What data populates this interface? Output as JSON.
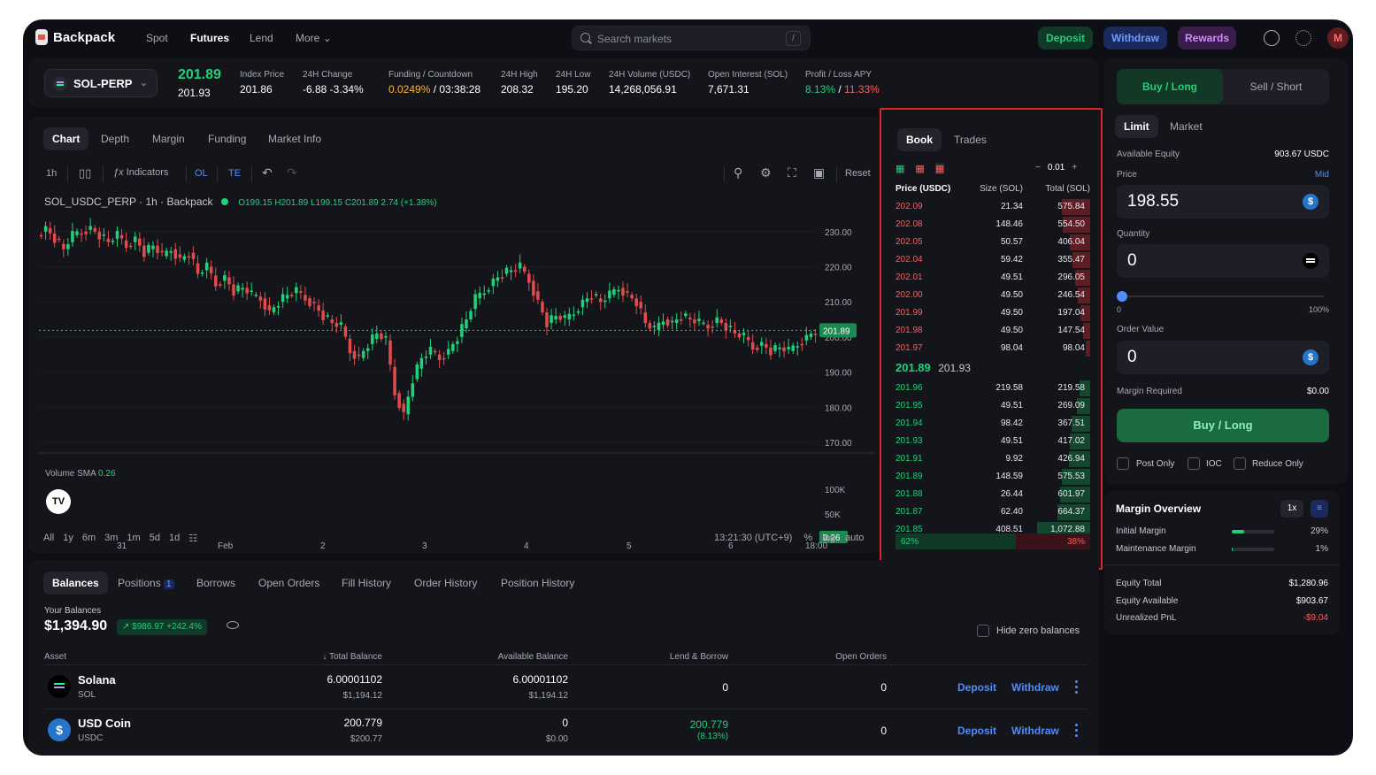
{
  "app": {
    "name": "Backpack"
  },
  "nav": {
    "items": [
      "Spot",
      "Futures",
      "Lend",
      "More"
    ],
    "active": "Futures"
  },
  "search": {
    "placeholder": "Search markets",
    "shortcut": "/"
  },
  "header_actions": {
    "deposit": "Deposit",
    "withdraw": "Withdraw",
    "rewards": "Rewards",
    "avatar": "M"
  },
  "colors": {
    "green": "#20d07a",
    "red": "#ff5b5b",
    "blue": "#4e8cff",
    "bg": "#0e0f14",
    "panel": "#14151b"
  },
  "market": {
    "symbol": "SOL-PERP",
    "last_price": "201.89",
    "mark_price": "201.93",
    "stats": [
      {
        "label": "Index Price",
        "value": "201.86"
      },
      {
        "label": "24H Change",
        "value": "-6.88 -3.34%"
      },
      {
        "label": "Funding / Countdown",
        "value": "0.0249%",
        "value2": " / 03:38:28"
      },
      {
        "label": "24H High",
        "value": "208.32"
      },
      {
        "label": "24H Low",
        "value": "195.20"
      },
      {
        "label": "24H Volume (USDC)",
        "value": "14,268,056.91"
      },
      {
        "label": "Open Interest (SOL)",
        "value": "7,671.31"
      },
      {
        "label": "Profit / Loss APY",
        "value": "8.13%",
        "value2": " / ",
        "value3": "11.33%"
      }
    ]
  },
  "chart_tabs": [
    "Chart",
    "Depth",
    "Margin",
    "Funding",
    "Market Info"
  ],
  "chart_toolbar": {
    "interval": "1h",
    "indicators": "Indicators",
    "ol": "OL",
    "te": "TE",
    "reset": "Reset"
  },
  "chart_legend": {
    "title": "SOL_USDC_PERP · 1h · Backpack",
    "o": "O199.15",
    "h": "H201.89",
    "l": "L199.15",
    "c": "C201.89",
    "chg": "2.74 (+1.38%)",
    "volume_label": "Volume SMA",
    "volume_value": "0.26"
  },
  "chart_data": {
    "type": "candlestick",
    "series_name": "SOL_USDC_PERP",
    "ylim": [
      170,
      235
    ],
    "y_ticks": [
      "230.00",
      "220.00",
      "210.00",
      "200.00",
      "190.00",
      "180.00",
      "170.00"
    ],
    "x_ticks": [
      "31",
      "Feb",
      "2",
      "3",
      "4",
      "5",
      "6",
      "18:00"
    ],
    "last_price_tag": "201.89",
    "volume_ticks": [
      "100K",
      "50K"
    ],
    "volume_tag": "0.26",
    "path": [
      229,
      231,
      228,
      225,
      229,
      230,
      231,
      229,
      227,
      229,
      226,
      228,
      224,
      226,
      223,
      225,
      222,
      224,
      218,
      220,
      215,
      217,
      213,
      214,
      212,
      211,
      207,
      210,
      212,
      213,
      211,
      209,
      206,
      204,
      203,
      196,
      194,
      198,
      201,
      199,
      184,
      178,
      188,
      194,
      196,
      194,
      196,
      200,
      205,
      211,
      213,
      216,
      218,
      219,
      220,
      216,
      210,
      204,
      206,
      205,
      207,
      210,
      212,
      210,
      212,
      214,
      212,
      210,
      204,
      202,
      205,
      204,
      206,
      205,
      204,
      203,
      205,
      203,
      201,
      200,
      197,
      198,
      196,
      197,
      196,
      198,
      200,
      201.89
    ]
  },
  "range_bar": {
    "ranges": [
      "All",
      "1y",
      "6m",
      "3m",
      "1m",
      "5d",
      "1d"
    ],
    "time": "13:21:30 (UTC+9)",
    "pct": "%",
    "log": "log",
    "auto": "auto"
  },
  "book": {
    "tabs": [
      "Book",
      "Trades"
    ],
    "tick": "0.01",
    "headers": [
      "Price (USDC)",
      "Size (SOL)",
      "Total (SOL)"
    ],
    "asks": [
      [
        "202.09",
        "21.34",
        "575.84"
      ],
      [
        "202.08",
        "148.46",
        "554.50"
      ],
      [
        "202.05",
        "50.57",
        "406.04"
      ],
      [
        "202.04",
        "59.42",
        "355.47"
      ],
      [
        "202.01",
        "49.51",
        "296.05"
      ],
      [
        "202.00",
        "49.50",
        "246.54"
      ],
      [
        "201.99",
        "49.50",
        "197.04"
      ],
      [
        "201.98",
        "49.50",
        "147.54"
      ],
      [
        "201.97",
        "98.04",
        "98.04"
      ]
    ],
    "mid": "201.89",
    "mark": "201.93",
    "bids": [
      [
        "201.96",
        "219.58",
        "219.58"
      ],
      [
        "201.95",
        "49.51",
        "269.09"
      ],
      [
        "201.94",
        "98.42",
        "367.51"
      ],
      [
        "201.93",
        "49.51",
        "417.02"
      ],
      [
        "201.91",
        "9.92",
        "426.94"
      ],
      [
        "201.89",
        "148.59",
        "575.53"
      ],
      [
        "201.88",
        "26.44",
        "601.97"
      ],
      [
        "201.87",
        "62.40",
        "664.37"
      ],
      [
        "201.85",
        "408.51",
        "1,072.88"
      ]
    ],
    "bid_pct": "62%",
    "ask_pct": "38%",
    "bid_ratio": 0.62
  },
  "order": {
    "side_buy": "Buy / Long",
    "side_sell": "Sell / Short",
    "types": [
      "Limit",
      "Market"
    ],
    "available_label": "Available Equity",
    "available_value": "903.67 USDC",
    "price_label": "Price",
    "mid_label": "Mid",
    "price_value": "198.55",
    "qty_label": "Quantity",
    "qty_value": "0",
    "slider_min": "0",
    "slider_max": "100%",
    "slider_level": 0,
    "value_label": "Order Value",
    "value_value": "0",
    "margin_label": "Margin Required",
    "margin_value": "$0.00",
    "submit": "Buy / Long",
    "options": [
      "Post Only",
      "IOC",
      "Reduce Only"
    ]
  },
  "margin_overview": {
    "title": "Margin Overview",
    "leverage": "1x",
    "rows": [
      {
        "label": "Initial Margin",
        "value": "29%",
        "level": 0.29
      },
      {
        "label": "Maintenance Margin",
        "value": "1%",
        "level": 0.01
      }
    ],
    "equity": [
      {
        "label": "Equity Total",
        "value": "$1,280.96"
      },
      {
        "label": "Equity Available",
        "value": "$903.67"
      },
      {
        "label": "Unrealized PnL",
        "value": "-$9.04"
      }
    ]
  },
  "balances": {
    "tabs": [
      "Balances",
      "Positions",
      "Borrows",
      "Open Orders",
      "Fill History",
      "Order History",
      "Position History"
    ],
    "positions_count": "1",
    "your_label": "Your Balances",
    "total": "$1,394.90",
    "change": "$986.97 +242.4%",
    "hide_zero": "Hide zero balances",
    "columns": [
      "Asset",
      "Total Balance",
      "Available Balance",
      "Lend & Borrow",
      "Open Orders"
    ],
    "rows": [
      {
        "name": "Solana",
        "ticker": "SOL",
        "total": "6.00001102",
        "total_usd": "$1,194.12",
        "avail": "6.00001102",
        "avail_usd": "$1,194.12",
        "lend": "0",
        "lend_sub": "",
        "open": "0",
        "deposit": "Deposit",
        "withdraw": "Withdraw"
      },
      {
        "name": "USD Coin",
        "ticker": "USDC",
        "total": "200.779",
        "total_usd": "$200.77",
        "avail": "0",
        "avail_usd": "$0.00",
        "lend": "200.779",
        "lend_sub": "(8.13%)",
        "open": "0",
        "deposit": "Deposit",
        "withdraw": "Withdraw"
      }
    ]
  }
}
